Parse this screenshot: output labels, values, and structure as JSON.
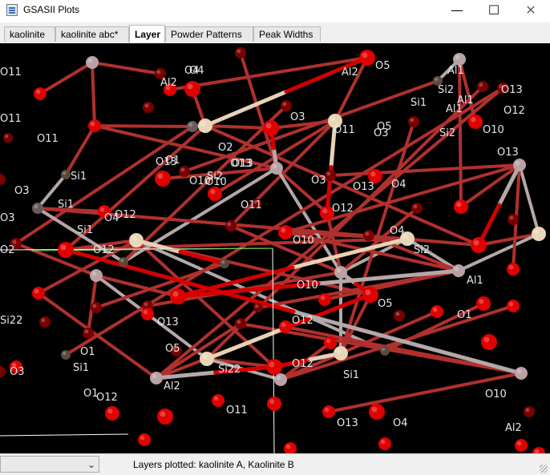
{
  "window": {
    "title": "GSASII Plots",
    "minimize": "—",
    "maximize": "☐",
    "close": "✕"
  },
  "tabs": [
    "kaolinite",
    "kaolinite abc*",
    "Layer",
    "Powder Patterns",
    "Peak Widths"
  ],
  "active_tab": "Layer",
  "plot": {
    "background": "#000000",
    "colors": {
      "O": "#e00000",
      "Al": "#b9a2a4",
      "Si": "#e8d6b8",
      "bond": "#b4a8a8"
    },
    "labels": [
      "O4",
      "O5",
      "Al2",
      "Al1",
      "O11",
      "O13",
      "O12",
      "O10",
      "Si1",
      "Si2",
      "O3",
      "O2",
      "O1",
      "O13",
      "Si1",
      "O11",
      "O3",
      "O12",
      "O4",
      "O10",
      "O12",
      "O11",
      "O13",
      "O3",
      "O4",
      "O10",
      "O5",
      "O12",
      "O13",
      "O1",
      "Si1",
      "Si2",
      "Al1",
      "Al2",
      "Si22"
    ],
    "layers_plotted": "Layers plotted: kaolinite A, Kaolinite B"
  },
  "status": {
    "combo_value": "",
    "text": "Layers plotted: kaolinite A, Kaolinite B"
  }
}
